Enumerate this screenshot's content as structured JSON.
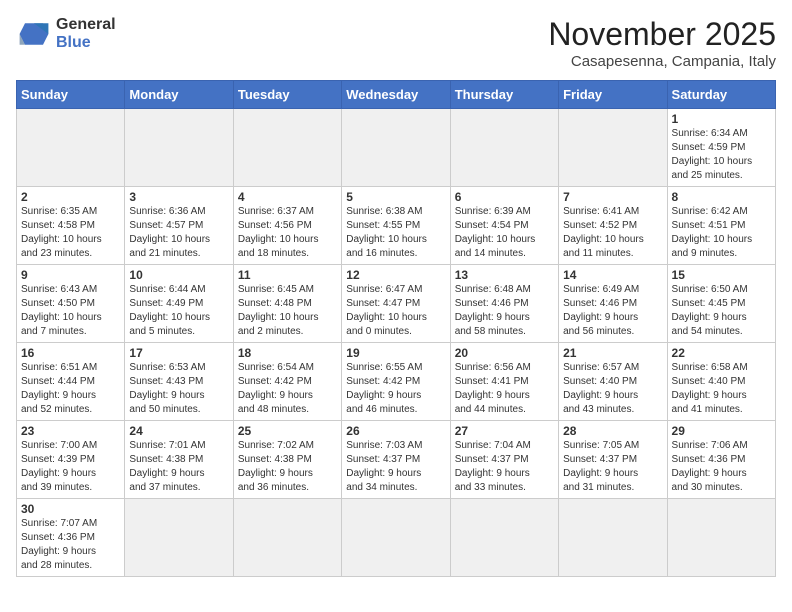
{
  "logo": {
    "line1": "General",
    "line2": "Blue"
  },
  "title": "November 2025",
  "subtitle": "Casapesenna, Campania, Italy",
  "days_of_week": [
    "Sunday",
    "Monday",
    "Tuesday",
    "Wednesday",
    "Thursday",
    "Friday",
    "Saturday"
  ],
  "weeks": [
    [
      {
        "day": "",
        "info": ""
      },
      {
        "day": "",
        "info": ""
      },
      {
        "day": "",
        "info": ""
      },
      {
        "day": "",
        "info": ""
      },
      {
        "day": "",
        "info": ""
      },
      {
        "day": "",
        "info": ""
      },
      {
        "day": "1",
        "info": "Sunrise: 6:34 AM\nSunset: 4:59 PM\nDaylight: 10 hours\nand 25 minutes."
      }
    ],
    [
      {
        "day": "2",
        "info": "Sunrise: 6:35 AM\nSunset: 4:58 PM\nDaylight: 10 hours\nand 23 minutes."
      },
      {
        "day": "3",
        "info": "Sunrise: 6:36 AM\nSunset: 4:57 PM\nDaylight: 10 hours\nand 21 minutes."
      },
      {
        "day": "4",
        "info": "Sunrise: 6:37 AM\nSunset: 4:56 PM\nDaylight: 10 hours\nand 18 minutes."
      },
      {
        "day": "5",
        "info": "Sunrise: 6:38 AM\nSunset: 4:55 PM\nDaylight: 10 hours\nand 16 minutes."
      },
      {
        "day": "6",
        "info": "Sunrise: 6:39 AM\nSunset: 4:54 PM\nDaylight: 10 hours\nand 14 minutes."
      },
      {
        "day": "7",
        "info": "Sunrise: 6:41 AM\nSunset: 4:52 PM\nDaylight: 10 hours\nand 11 minutes."
      },
      {
        "day": "8",
        "info": "Sunrise: 6:42 AM\nSunset: 4:51 PM\nDaylight: 10 hours\nand 9 minutes."
      }
    ],
    [
      {
        "day": "9",
        "info": "Sunrise: 6:43 AM\nSunset: 4:50 PM\nDaylight: 10 hours\nand 7 minutes."
      },
      {
        "day": "10",
        "info": "Sunrise: 6:44 AM\nSunset: 4:49 PM\nDaylight: 10 hours\nand 5 minutes."
      },
      {
        "day": "11",
        "info": "Sunrise: 6:45 AM\nSunset: 4:48 PM\nDaylight: 10 hours\nand 2 minutes."
      },
      {
        "day": "12",
        "info": "Sunrise: 6:47 AM\nSunset: 4:47 PM\nDaylight: 10 hours\nand 0 minutes."
      },
      {
        "day": "13",
        "info": "Sunrise: 6:48 AM\nSunset: 4:46 PM\nDaylight: 9 hours\nand 58 minutes."
      },
      {
        "day": "14",
        "info": "Sunrise: 6:49 AM\nSunset: 4:46 PM\nDaylight: 9 hours\nand 56 minutes."
      },
      {
        "day": "15",
        "info": "Sunrise: 6:50 AM\nSunset: 4:45 PM\nDaylight: 9 hours\nand 54 minutes."
      }
    ],
    [
      {
        "day": "16",
        "info": "Sunrise: 6:51 AM\nSunset: 4:44 PM\nDaylight: 9 hours\nand 52 minutes."
      },
      {
        "day": "17",
        "info": "Sunrise: 6:53 AM\nSunset: 4:43 PM\nDaylight: 9 hours\nand 50 minutes."
      },
      {
        "day": "18",
        "info": "Sunrise: 6:54 AM\nSunset: 4:42 PM\nDaylight: 9 hours\nand 48 minutes."
      },
      {
        "day": "19",
        "info": "Sunrise: 6:55 AM\nSunset: 4:42 PM\nDaylight: 9 hours\nand 46 minutes."
      },
      {
        "day": "20",
        "info": "Sunrise: 6:56 AM\nSunset: 4:41 PM\nDaylight: 9 hours\nand 44 minutes."
      },
      {
        "day": "21",
        "info": "Sunrise: 6:57 AM\nSunset: 4:40 PM\nDaylight: 9 hours\nand 43 minutes."
      },
      {
        "day": "22",
        "info": "Sunrise: 6:58 AM\nSunset: 4:40 PM\nDaylight: 9 hours\nand 41 minutes."
      }
    ],
    [
      {
        "day": "23",
        "info": "Sunrise: 7:00 AM\nSunset: 4:39 PM\nDaylight: 9 hours\nand 39 minutes."
      },
      {
        "day": "24",
        "info": "Sunrise: 7:01 AM\nSunset: 4:38 PM\nDaylight: 9 hours\nand 37 minutes."
      },
      {
        "day": "25",
        "info": "Sunrise: 7:02 AM\nSunset: 4:38 PM\nDaylight: 9 hours\nand 36 minutes."
      },
      {
        "day": "26",
        "info": "Sunrise: 7:03 AM\nSunset: 4:37 PM\nDaylight: 9 hours\nand 34 minutes."
      },
      {
        "day": "27",
        "info": "Sunrise: 7:04 AM\nSunset: 4:37 PM\nDaylight: 9 hours\nand 33 minutes."
      },
      {
        "day": "28",
        "info": "Sunrise: 7:05 AM\nSunset: 4:37 PM\nDaylight: 9 hours\nand 31 minutes."
      },
      {
        "day": "29",
        "info": "Sunrise: 7:06 AM\nSunset: 4:36 PM\nDaylight: 9 hours\nand 30 minutes."
      }
    ],
    [
      {
        "day": "30",
        "info": "Sunrise: 7:07 AM\nSunset: 4:36 PM\nDaylight: 9 hours\nand 28 minutes."
      },
      {
        "day": "",
        "info": ""
      },
      {
        "day": "",
        "info": ""
      },
      {
        "day": "",
        "info": ""
      },
      {
        "day": "",
        "info": ""
      },
      {
        "day": "",
        "info": ""
      },
      {
        "day": "",
        "info": ""
      }
    ]
  ]
}
